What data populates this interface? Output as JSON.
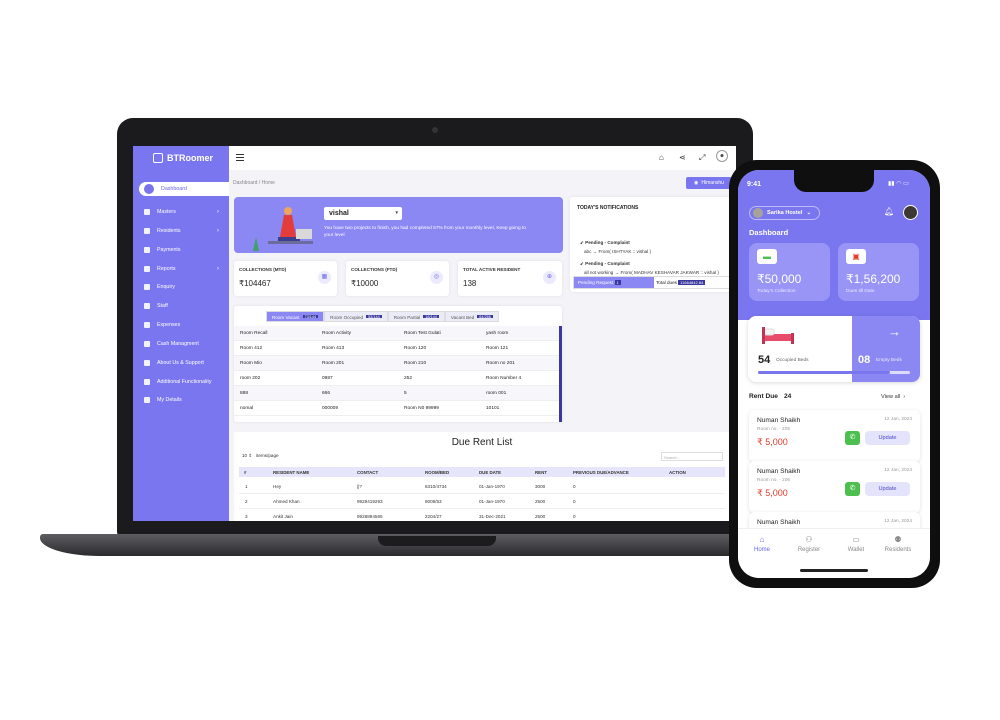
{
  "laptop": {
    "brand": "BTRoomer",
    "sidebar": [
      {
        "label": "Dashboard",
        "icon": "home-icon",
        "active": true
      },
      {
        "label": "Masters",
        "icon": "grid-icon",
        "chevron": true
      },
      {
        "label": "Residents",
        "icon": "users-icon",
        "chevron": true
      },
      {
        "label": "Payments",
        "icon": "rupee-icon"
      },
      {
        "label": "Reports",
        "icon": "report-icon",
        "chevron": true
      },
      {
        "label": "Enquiry",
        "icon": "phone-icon"
      },
      {
        "label": "Staff",
        "icon": "staff-icon"
      },
      {
        "label": "Expenses",
        "icon": "tag-icon"
      },
      {
        "label": "Cash Managment",
        "icon": "cash-icon"
      },
      {
        "label": "About Us & Support",
        "icon": "info-icon"
      },
      {
        "label": "Additional Functionality",
        "icon": "function-icon"
      },
      {
        "label": "My Details",
        "icon": "settings-icon"
      }
    ],
    "breadcrumb": "Dashboard  /  Home",
    "user_button": "Himanshu",
    "banner": {
      "select_value": "vishal",
      "message": "You have two projects to finish, you had completed 57% from your monthly level, Keep going to your level"
    },
    "stats": [
      {
        "label": "COLLECTIONS (MTD)",
        "value": "₹104467"
      },
      {
        "label": "COLLECTIONS (FTD)",
        "value": "₹10000"
      },
      {
        "label": "TOTAL ACTIVE RESIDENT",
        "value": "138"
      }
    ],
    "notifications": {
      "title": "TODAY'S NOTIFICATIONS",
      "items": [
        {
          "head": "Pending - Complaint",
          "body": "abc → From( ISHTYAK :: vishal )"
        },
        {
          "head": "Pending - Complaint",
          "body": "all not working → From( MADHAV KESHAVAR JAKWAR :: vishal )"
        }
      ],
      "pending_label": "Pending Request",
      "pending_count": "1",
      "total_dues_label": "Total dues",
      "total_dues_value": "11664842.84"
    },
    "room_tabs": [
      {
        "label": "Room Vacant",
        "count": "73/144",
        "active": true
      },
      {
        "label": "Room Occupied",
        "count": "53/144"
      },
      {
        "label": "Room Partial",
        "count": "18/144"
      },
      {
        "label": "Vacant Bed",
        "count": "64/286"
      }
    ],
    "room_rows": [
      [
        "Room Recall",
        "Room Activity",
        "Room Test Gulati",
        "yash room"
      ],
      [
        "Room 412",
        "Room 413",
        "Room 120",
        "Room 121"
      ],
      [
        "Room Mio",
        "Room 201",
        "Room 210",
        "Room no 201"
      ],
      [
        "room 202",
        "0987",
        "252",
        "Room Number 4"
      ],
      [
        "888",
        "666",
        "5",
        "room 001"
      ],
      [
        "nomal",
        "000009",
        "Room N0 99999",
        "10101"
      ]
    ],
    "due_rent": {
      "title": "Due Rent List",
      "items_per_page": "10",
      "items_label": "items/page",
      "search_placeholder": "Search...",
      "columns": [
        "#",
        "RESIDENT NAME",
        "CONTACT",
        "ROOM/BED",
        "DUE DATE",
        "RENT",
        "PREVIOUS DUE/ADVANCE",
        "ACTION"
      ],
      "rows": [
        [
          "1",
          "Hey",
          "||?",
          "8310/4734",
          "01-Jan-1970",
          "3000",
          "0"
        ],
        [
          "2",
          "Ahmed Khan",
          "9929419293",
          "8009/53",
          "01-Jan-1970",
          "2500",
          "0"
        ],
        [
          "3",
          "Ankit Jain",
          "9928894565",
          "2204/27",
          "31-Dec-2021",
          "2500",
          "0"
        ]
      ]
    }
  },
  "phone": {
    "time": "9:41",
    "hostel": "Sarika Hostel",
    "title": "Dashboard",
    "cards": [
      {
        "value": "₹50,000",
        "label": "Today's Collection",
        "icon": "cash-icon"
      },
      {
        "value": "₹1,56,200",
        "label": "Dues till Date",
        "icon": "calendar-icon"
      }
    ],
    "beds": {
      "occupied": "54",
      "occupied_label": "Occupied Beds",
      "empty": "08",
      "empty_label": "Empty Beds",
      "occupied_fraction": 0.87
    },
    "rent_due": {
      "title": "Rent Due",
      "count": "24",
      "view_all": "View all"
    },
    "dues": [
      {
        "name": "Numan Shaikh",
        "date": "12 Jan, 2024",
        "room": "Room no. - 205",
        "amount": "₹ 5,000",
        "button": "Update"
      },
      {
        "name": "Numan Shaikh",
        "date": "12 Jan, 2024",
        "room": "Room no. - 206",
        "amount": "₹ 5,000",
        "button": "Update"
      },
      {
        "name": "Numan Shaikh",
        "date": "12 Jan, 2024"
      }
    ],
    "nav": [
      {
        "label": "Home",
        "icon": "home-icon",
        "active": true
      },
      {
        "label": "Register",
        "icon": "user-add-icon"
      },
      {
        "label": "Wallet",
        "icon": "wallet-icon"
      },
      {
        "label": "Residents",
        "icon": "users-icon"
      }
    ]
  },
  "colors": {
    "accent": "#7a76f0",
    "dark_badge": "#3a379e",
    "due_red": "#e33a2a",
    "call_green": "#4cbf4f"
  }
}
